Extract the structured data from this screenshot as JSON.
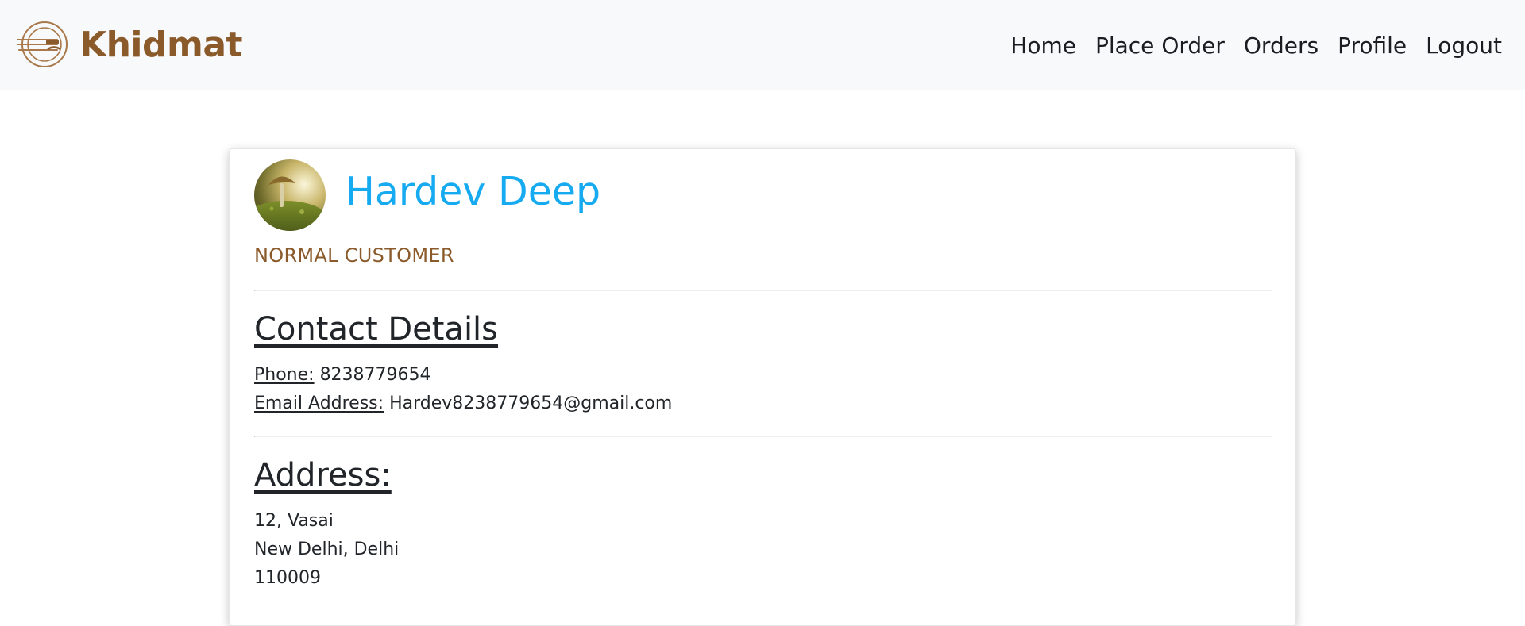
{
  "brand": {
    "name": "Khidmat",
    "logo_icon": "plate-cutlery-icon",
    "color": "#8a5a2b"
  },
  "nav": {
    "items": [
      {
        "label": "Home"
      },
      {
        "label": "Place Order"
      },
      {
        "label": "Orders"
      },
      {
        "label": "Profile"
      },
      {
        "label": "Logout"
      }
    ]
  },
  "profile": {
    "avatar_icon": "mushroom-avatar-image",
    "name": "Hardev Deep",
    "name_color": "#16aaf0",
    "role": "NORMAL CUSTOMER"
  },
  "contact": {
    "heading": "Contact Details",
    "phone_label": "Phone:",
    "phone": "8238779654",
    "email_label": "Email Address:",
    "email": "Hardev8238779654@gmail.com"
  },
  "address": {
    "heading": "Address:",
    "line1": "12, Vasai",
    "line2": "New Delhi, Delhi",
    "line3": "110009"
  }
}
